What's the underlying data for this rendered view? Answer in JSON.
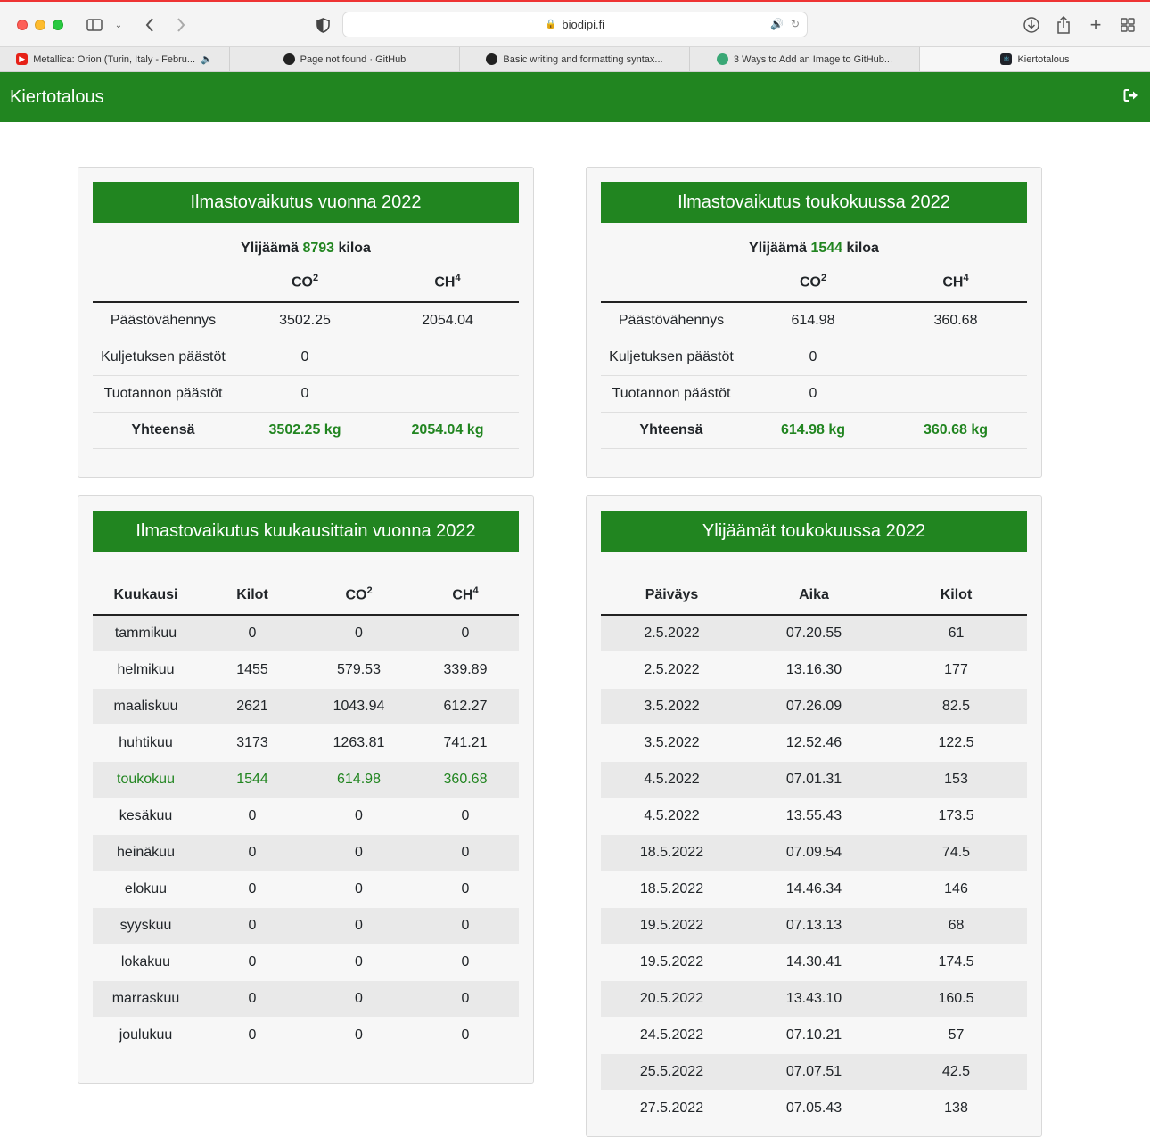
{
  "browser": {
    "url": "biodipi.fi",
    "tabs": [
      {
        "label": "Metallica: Orion (Turin, Italy - Febru...",
        "favicon_color": "#e62117"
      },
      {
        "label": "Page not found · GitHub",
        "favicon_color": "#222222"
      },
      {
        "label": "Basic writing and formatting syntax...",
        "favicon_color": "#222222"
      },
      {
        "label": "3 Ways to Add an Image to GitHub...",
        "favicon_color": "#3aa876"
      },
      {
        "label": "Kiertotalous",
        "favicon_color": "#20232a"
      }
    ]
  },
  "navbar": {
    "brand": "Kiertotalous"
  },
  "cards": {
    "year": {
      "title": "Ilmastovaikutus vuonna 2022",
      "surplus_prefix": "Ylijäämä",
      "surplus_value": "8793",
      "surplus_suffix": "kiloa",
      "col_co2": "CO",
      "col_co2_sup": "2",
      "col_ch4": "CH",
      "col_ch4_sup": "4",
      "rows": [
        {
          "label": "Päästövähennys",
          "co2": "3502.25",
          "ch4": "2054.04"
        },
        {
          "label": "Kuljetuksen päästöt",
          "co2": "0",
          "ch4": ""
        },
        {
          "label": "Tuotannon päästöt",
          "co2": "0",
          "ch4": ""
        }
      ],
      "total": {
        "label": "Yhteensä",
        "co2": "3502.25 kg",
        "ch4": "2054.04 kg"
      }
    },
    "month": {
      "title": "Ilmastovaikutus toukokuussa 2022",
      "surplus_prefix": "Ylijäämä",
      "surplus_value": "1544",
      "surplus_suffix": "kiloa",
      "col_co2": "CO",
      "col_co2_sup": "2",
      "col_ch4": "CH",
      "col_ch4_sup": "4",
      "rows": [
        {
          "label": "Päästövähennys",
          "co2": "614.98",
          "ch4": "360.68"
        },
        {
          "label": "Kuljetuksen päästöt",
          "co2": "0",
          "ch4": ""
        },
        {
          "label": "Tuotannon päästöt",
          "co2": "0",
          "ch4": ""
        }
      ],
      "total": {
        "label": "Yhteensä",
        "co2": "614.98 kg",
        "ch4": "360.68 kg"
      }
    },
    "monthly": {
      "title": "Ilmastovaikutus kuukausittain vuonna 2022",
      "headers": {
        "month": "Kuukausi",
        "kilos": "Kilot",
        "co2": "CO",
        "co2_sup": "2",
        "ch4": "CH",
        "ch4_sup": "4"
      },
      "current_month": "toukokuu",
      "rows": [
        {
          "month": "tammikuu",
          "kilos": "0",
          "co2": "0",
          "ch4": "0"
        },
        {
          "month": "helmikuu",
          "kilos": "1455",
          "co2": "579.53",
          "ch4": "339.89"
        },
        {
          "month": "maaliskuu",
          "kilos": "2621",
          "co2": "1043.94",
          "ch4": "612.27"
        },
        {
          "month": "huhtikuu",
          "kilos": "3173",
          "co2": "1263.81",
          "ch4": "741.21"
        },
        {
          "month": "toukokuu",
          "kilos": "1544",
          "co2": "614.98",
          "ch4": "360.68"
        },
        {
          "month": "kesäkuu",
          "kilos": "0",
          "co2": "0",
          "ch4": "0"
        },
        {
          "month": "heinäkuu",
          "kilos": "0",
          "co2": "0",
          "ch4": "0"
        },
        {
          "month": "elokuu",
          "kilos": "0",
          "co2": "0",
          "ch4": "0"
        },
        {
          "month": "syyskuu",
          "kilos": "0",
          "co2": "0",
          "ch4": "0"
        },
        {
          "month": "lokakuu",
          "kilos": "0",
          "co2": "0",
          "ch4": "0"
        },
        {
          "month": "marraskuu",
          "kilos": "0",
          "co2": "0",
          "ch4": "0"
        },
        {
          "month": "joulukuu",
          "kilos": "0",
          "co2": "0",
          "ch4": "0"
        }
      ]
    },
    "surpluses": {
      "title": "Ylijäämät toukokuussa 2022",
      "headers": {
        "date": "Päiväys",
        "time": "Aika",
        "kilos": "Kilot"
      },
      "rows": [
        {
          "date": "2.5.2022",
          "time": "07.20.55",
          "kilos": "61"
        },
        {
          "date": "2.5.2022",
          "time": "13.16.30",
          "kilos": "177"
        },
        {
          "date": "3.5.2022",
          "time": "07.26.09",
          "kilos": "82.5"
        },
        {
          "date": "3.5.2022",
          "time": "12.52.46",
          "kilos": "122.5"
        },
        {
          "date": "4.5.2022",
          "time": "07.01.31",
          "kilos": "153"
        },
        {
          "date": "4.5.2022",
          "time": "13.55.43",
          "kilos": "173.5"
        },
        {
          "date": "18.5.2022",
          "time": "07.09.54",
          "kilos": "74.5"
        },
        {
          "date": "18.5.2022",
          "time": "14.46.34",
          "kilos": "146"
        },
        {
          "date": "19.5.2022",
          "time": "07.13.13",
          "kilos": "68"
        },
        {
          "date": "19.5.2022",
          "time": "14.30.41",
          "kilos": "174.5"
        },
        {
          "date": "20.5.2022",
          "time": "13.43.10",
          "kilos": "160.5"
        },
        {
          "date": "24.5.2022",
          "time": "07.10.21",
          "kilos": "57"
        },
        {
          "date": "25.5.2022",
          "time": "07.07.51",
          "kilos": "42.5"
        },
        {
          "date": "27.5.2022",
          "time": "07.05.43",
          "kilos": "138"
        }
      ]
    }
  }
}
